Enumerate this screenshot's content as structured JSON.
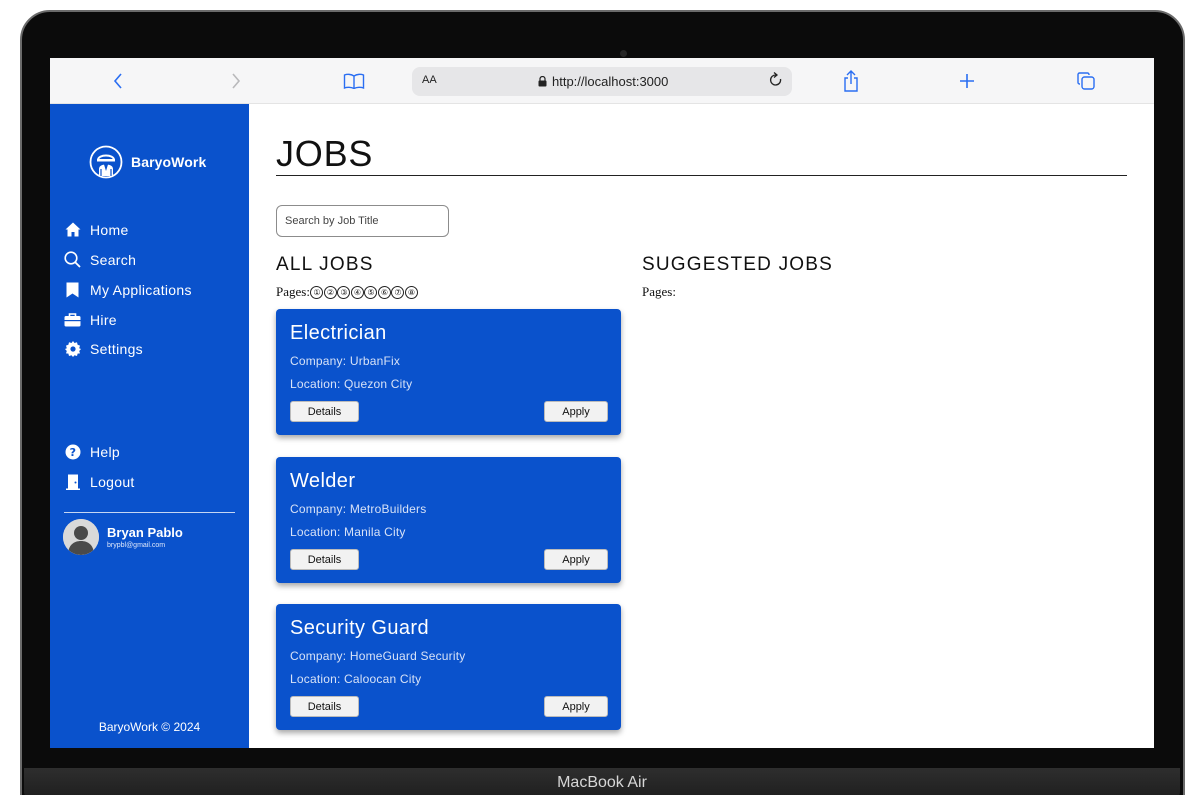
{
  "device": {
    "label": "MacBook Air"
  },
  "browser": {
    "text_size_label": "AA",
    "url": "http://localhost:3000",
    "icons": [
      "back-icon",
      "forward-icon",
      "bookmarks-icon",
      "lock-icon",
      "reload-icon",
      "share-icon",
      "new-tab-icon",
      "tabs-icon"
    ]
  },
  "sidebar": {
    "brand": "BaryoWork",
    "items": [
      {
        "label": "Home",
        "icon": "home-icon"
      },
      {
        "label": "Search",
        "icon": "search-icon"
      },
      {
        "label": "My Applications",
        "icon": "bookmark-icon"
      },
      {
        "label": "Hire",
        "icon": "briefcase-icon"
      },
      {
        "label": "Settings",
        "icon": "gear-icon"
      }
    ],
    "secondary": [
      {
        "label": "Help",
        "icon": "help-icon"
      },
      {
        "label": "Logout",
        "icon": "logout-icon"
      }
    ],
    "user": {
      "name": "Bryan Pablo",
      "email": "brypbl@gmail.com"
    },
    "footer": "BaryoWork © 2024",
    "accent_color": "#0a52cc"
  },
  "main": {
    "title": "JOBS",
    "search": {
      "placeholder": "Search by Job Title",
      "value": ""
    },
    "all_jobs": {
      "title": "ALL JOBS",
      "pages_label": "Pages:",
      "pages": [
        "①",
        "②",
        "③",
        "④",
        "⑤",
        "⑥",
        "⑦",
        "⑧"
      ]
    },
    "suggested_jobs": {
      "title": "SUGGESTED JOBS",
      "pages_label": "Pages:"
    },
    "jobs": [
      {
        "title": "Electrician",
        "company": "Company: UrbanFix",
        "location": "Location: Quezon City",
        "details_label": "Details",
        "apply_label": "Apply"
      },
      {
        "title": "Welder",
        "company": "Company: MetroBuilders",
        "location": "Location: Manila City",
        "details_label": "Details",
        "apply_label": "Apply"
      },
      {
        "title": "Security Guard",
        "company": "Company: HomeGuard Security",
        "location": "Location: Caloocan City",
        "details_label": "Details",
        "apply_label": "Apply"
      }
    ]
  }
}
